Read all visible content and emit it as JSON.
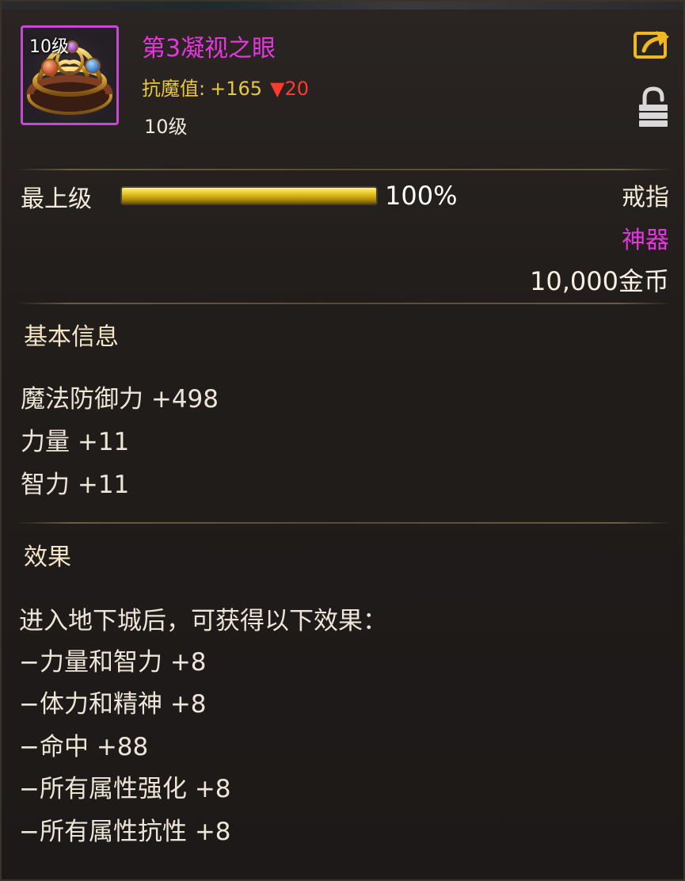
{
  "item": {
    "icon_level": "10级",
    "name": "第3凝视之眼",
    "resist_label": "抗魔值:",
    "resist_value": "+165",
    "resist_change": "▼20",
    "level": "10级",
    "rarity_color": "#e536e0",
    "icon": "gold-ring-icon"
  },
  "header_icons": {
    "share": "share-icon",
    "lock": "lock-icon"
  },
  "upgrade": {
    "rank_label": "最上级",
    "progress_text": "100%",
    "progress_fraction": 1.0
  },
  "meta": {
    "type": "戒指",
    "rarity": "神器",
    "price": "10,000金币"
  },
  "basic_info": {
    "title": "基本信息",
    "stats": [
      "魔法防御力 +498",
      "力量 +11",
      "智力 +11"
    ]
  },
  "effects": {
    "title": "效果",
    "intro": "进入地下城后，可获得以下效果：",
    "list": [
      "−力量和智力 +8",
      "−体力和精神 +8",
      "−命中 +88",
      "−所有属性强化 +8",
      "−所有属性抗性 +8"
    ]
  }
}
